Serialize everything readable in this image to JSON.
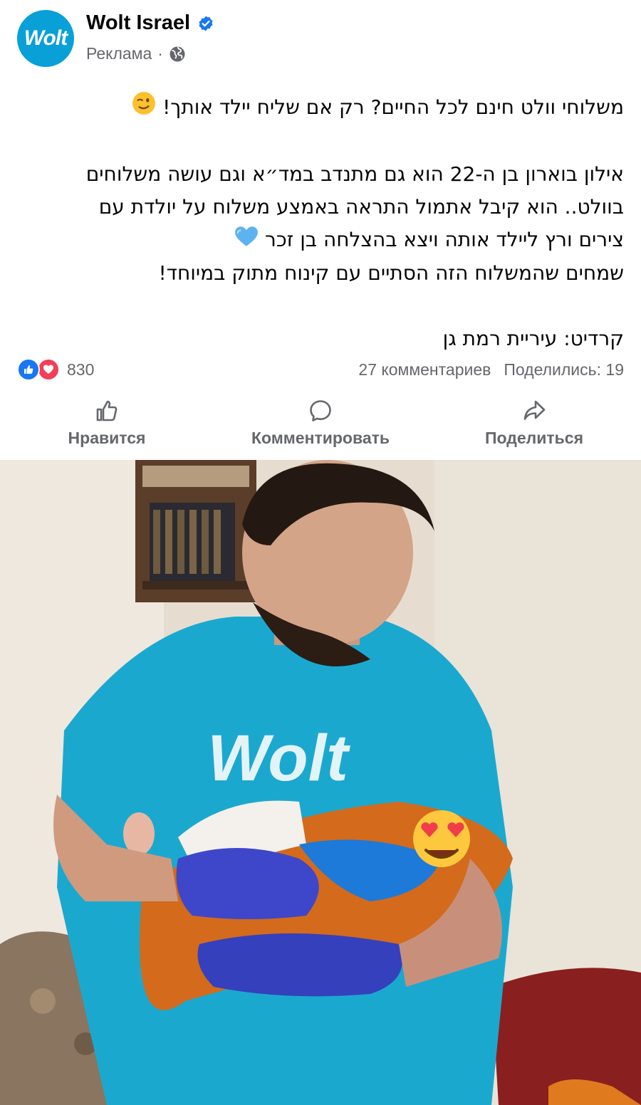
{
  "header": {
    "page_name": "Wolt Israel",
    "avatar_text": "Wolt",
    "sponsored_label": "Реклама",
    "separator": "·"
  },
  "post": {
    "line1": "משלוחי וולט חינם לכל החיים? רק אם שליח יילד אותך!",
    "para2_line1": "אילון בוארון בן ה-22 הוא גם מתנדב במד״א וגם עושה משלוחים",
    "para2_line2": "בוולט.. הוא קיבל אתמול התראה באמצע משלוח על יולדת עם",
    "para2_line3": "צירים ורץ ליילד אותה ויצא בהצלחה בן זכר",
    "para2_line4": "שמחים שהמשלוח הזה הסתיים עם קינוח מתוק במיוחד!",
    "credit": "קרדיט: עיריית רמת גן"
  },
  "stats": {
    "reaction_count": "830",
    "comments": "27 комментариев",
    "shares": "Поделились: 19"
  },
  "actions": {
    "like": "Нравится",
    "comment": "Комментировать",
    "share": "Поделиться"
  },
  "photo": {
    "shirt_logo": "Wolt"
  },
  "colors": {
    "wolt_blue": "#08a0d6",
    "facebook_blue": "#1877f2",
    "love_red": "#f33e58",
    "secondary_text": "#65676b"
  },
  "icons": [
    "verified-badge-icon",
    "globe-icon",
    "wink-emoji-icon",
    "blue-heart-icon",
    "like-reaction-icon",
    "love-reaction-icon",
    "thumbs-up-icon",
    "comment-bubble-icon",
    "share-arrow-icon",
    "heart-eyes-emoji-icon"
  ]
}
